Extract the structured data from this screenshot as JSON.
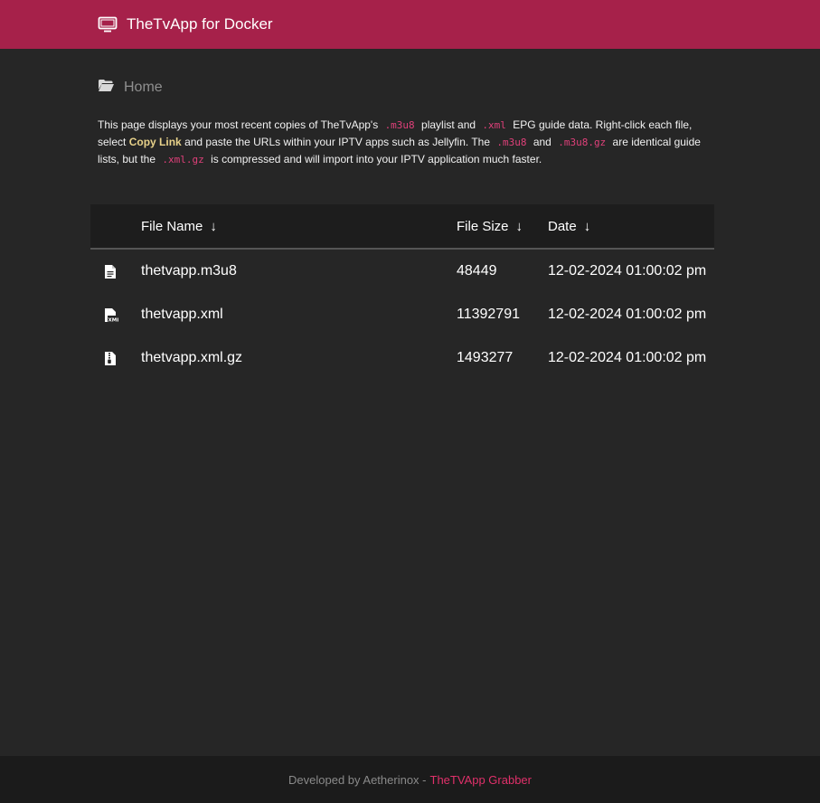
{
  "header": {
    "title": "TheTvApp for Docker",
    "icon": "tv-icon"
  },
  "breadcrumb": {
    "label": "Home",
    "icon": "folder-open-icon"
  },
  "intro": {
    "t1": "This page displays your most recent copies of TheTvApp's",
    "code1": ".m3u8",
    "t2": "playlist and",
    "code2": ".xml",
    "t3": "EPG guide data. Right-click each file, select",
    "bold1": "Copy Link",
    "t4": "and paste the URLs within your IPTV apps such as Jellyfin. The",
    "code3": ".m3u8",
    "t5": "and",
    "code4": ".m3u8.gz",
    "t6": "are identical guide lists, but the",
    "code5": ".xml.gz",
    "t7": "is compressed and will import into your IPTV application much faster."
  },
  "table": {
    "columns": {
      "name": "File Name",
      "size": "File Size",
      "date": "Date"
    },
    "sort_arrow": "↓",
    "rows": [
      {
        "icon": "file-text-icon",
        "name": "thetvapp.m3u8",
        "size": "48449",
        "date": "12-02-2024 01:00:02 pm"
      },
      {
        "icon": "file-xml-icon",
        "name": "thetvapp.xml",
        "size": "11392791",
        "date": "12-02-2024 01:00:02 pm"
      },
      {
        "icon": "file-archive-icon",
        "name": "thetvapp.xml.gz",
        "size": "1493277",
        "date": "12-02-2024 01:00:02 pm"
      }
    ]
  },
  "footer": {
    "prefix": "Developed by Aetherinox -",
    "link": "TheTVApp Grabber"
  },
  "colors": {
    "header_bg": "#a6214a",
    "page_bg": "#262626",
    "table_header_bg": "#1d1d1d",
    "footer_bg": "#1b1b1b",
    "code_pink": "#e0407a",
    "link_pink": "#e0306a",
    "highlight_gold": "#e8d28a"
  }
}
